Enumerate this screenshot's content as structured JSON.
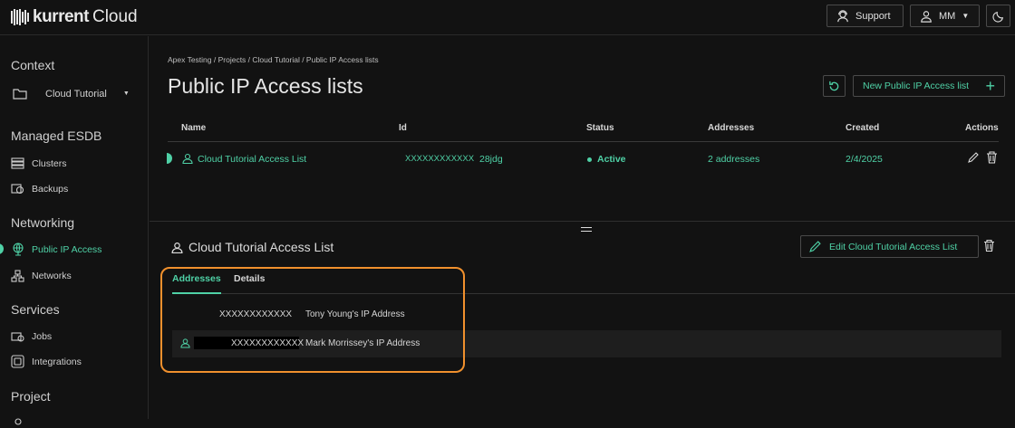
{
  "app": {
    "logo_text": "kurrent",
    "logo_suffix": "Cloud",
    "support_label": "Support",
    "user_initials": "MM",
    "accent_color": "#4fd1a6",
    "callout_color": "#f0902d"
  },
  "sidebar": {
    "context_heading": "Context",
    "context_value": "Cloud Tutorial",
    "sections": [
      {
        "heading": "Managed ESDB",
        "items": [
          {
            "label": "Clusters",
            "icon": "server-stack-icon"
          },
          {
            "label": "Backups",
            "icon": "backup-icon"
          }
        ]
      },
      {
        "heading": "Networking",
        "items": [
          {
            "label": "Public IP Access",
            "icon": "globe-icon"
          },
          {
            "label": "Networks",
            "icon": "network-icon"
          }
        ]
      },
      {
        "heading": "Services",
        "items": [
          {
            "label": "Jobs",
            "icon": "jobs-icon"
          },
          {
            "label": "Integrations",
            "icon": "integrations-icon"
          }
        ]
      },
      {
        "heading": "Project",
        "items": []
      }
    ]
  },
  "main": {
    "breadcrumb": "Apex Testing / Projects / Cloud Tutorial / Public IP Access lists",
    "title": "Public IP Access lists",
    "new_button_label": "New Public IP Access list",
    "table": {
      "columns": [
        "Name",
        "Id",
        "Status",
        "Addresses",
        "Created",
        "Actions"
      ],
      "rows": [
        {
          "name": "Cloud Tutorial Access List",
          "id_masked": "XXXXXXXXXXXX",
          "id_suffix": "28jdg",
          "status": "Active",
          "addresses": "2 addresses",
          "created": "2/4/2025"
        }
      ]
    }
  },
  "detail": {
    "title": "Cloud Tutorial Access List",
    "edit_button_label": "Edit Cloud Tutorial Access List",
    "tabs": [
      "Addresses",
      "Details"
    ],
    "addresses": [
      {
        "address": "XXXXXXXXXXXX",
        "comment": "Tony Young's IP Address"
      },
      {
        "address": "XXXXXXXXXXXX",
        "comment": "Mark Morrissey's IP Address"
      }
    ]
  }
}
